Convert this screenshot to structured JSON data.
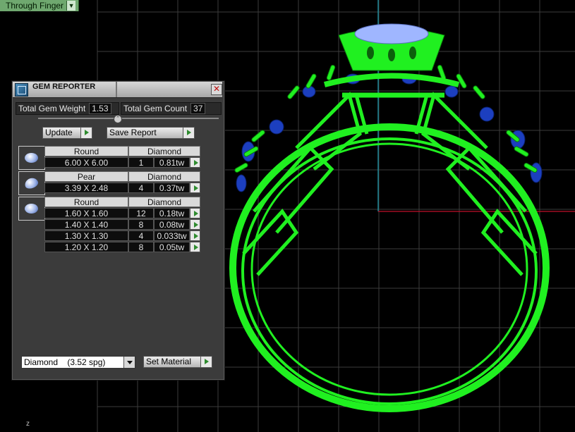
{
  "viewport": {
    "tab_label": "Through Finger",
    "axis_label": "z",
    "colors": {
      "background": "#000000",
      "grid": "#3c3c3c",
      "axis_vertical": "#1aa0b4",
      "axis_horizontal": "#c0102a",
      "ring": "#20f020",
      "gem_blue": "#2040c0",
      "center_stone": "#9fb6ff"
    }
  },
  "gem_reporter": {
    "title": "GEM REPORTER",
    "close_icon": "close-icon",
    "total_weight_label": "Total Gem Weight",
    "total_weight_value": "1.53",
    "total_count_label": "Total Gem Count",
    "total_count_value": "37",
    "update_label": "Update",
    "save_report_label": "Save Report",
    "groups": [
      {
        "shape": "Round",
        "material": "Diamond",
        "icon": "round-gem-icon",
        "rows": [
          {
            "size": "6.00 X 6.00",
            "count": "1",
            "weight": "0.81tw"
          }
        ]
      },
      {
        "shape": "Pear",
        "material": "Diamond",
        "icon": "pear-gem-icon",
        "rows": [
          {
            "size": "3.39 X 2.48",
            "count": "4",
            "weight": "0.37tw"
          }
        ]
      },
      {
        "shape": "Round",
        "material": "Diamond",
        "icon": "round-gem-icon",
        "rows": [
          {
            "size": "1.60 X 1.60",
            "count": "12",
            "weight": "0.18tw"
          },
          {
            "size": "1.40 X 1.40",
            "count": "8",
            "weight": "0.08tw"
          },
          {
            "size": "1.30 X 1.30",
            "count": "4",
            "weight": "0.033tw"
          },
          {
            "size": "1.20 X 1.20",
            "count": "8",
            "weight": "0.05tw"
          }
        ]
      }
    ],
    "material_select_value": "Diamond    (3.52 spg)",
    "set_material_label": "Set Material"
  }
}
